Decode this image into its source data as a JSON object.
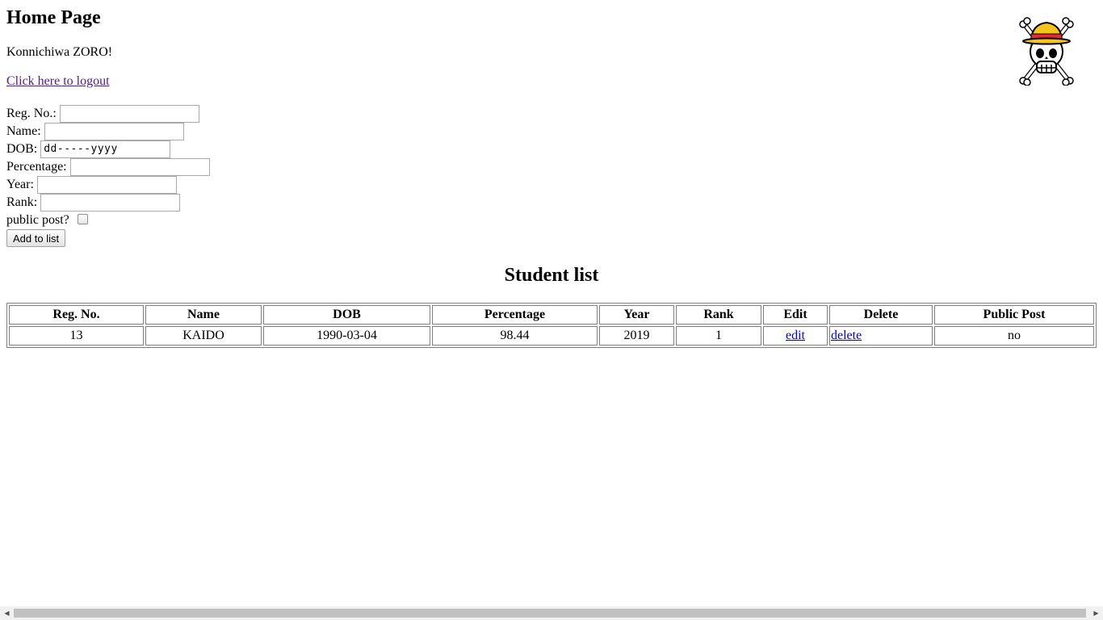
{
  "header": {
    "title": "Home Page",
    "greeting": "Konnichiwa ZORO!",
    "logout_link": "Click here to logout"
  },
  "logo": {
    "icon": "straw-hat-jolly-roger-icon",
    "hat_color": "#f5c518",
    "band_color": "#e32b2b"
  },
  "form": {
    "reg_no_label": "Reg. No.:",
    "name_label": "Name:",
    "dob_label": "DOB:",
    "dob_placeholder": "dd-----yyyy",
    "percentage_label": "Percentage:",
    "year_label": "Year:",
    "rank_label": "Rank:",
    "public_post_label": "public post?",
    "add_button": "Add to list"
  },
  "list": {
    "title": "Student list",
    "columns": [
      "Reg. No.",
      "Name",
      "DOB",
      "Percentage",
      "Year",
      "Rank",
      "Edit",
      "Delete",
      "Public Post"
    ],
    "rows": [
      {
        "reg_no": "13",
        "name": "KAIDO",
        "dob": "1990-03-04",
        "percentage": "98.44",
        "year": "2019",
        "rank": "1",
        "edit": "edit",
        "delete": "delete",
        "public_post": "no"
      }
    ]
  },
  "scrollbar": {
    "left_arrow": "◀",
    "right_arrow": "▶"
  }
}
